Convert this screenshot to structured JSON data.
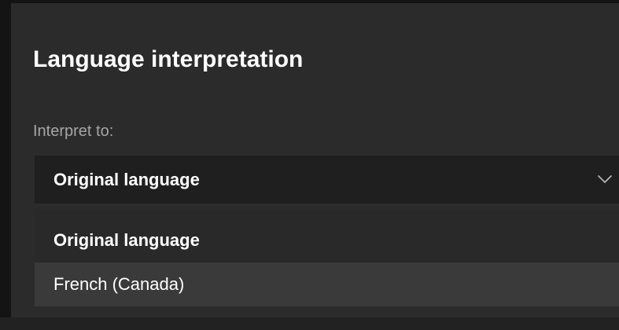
{
  "dialog": {
    "title": "Language interpretation",
    "field_label": "Interpret to:",
    "select": {
      "selected_value": "Original language",
      "icon": "chevron-down-icon"
    },
    "options": [
      {
        "label": "Original language",
        "selected": true
      },
      {
        "label": "French (Canada)",
        "hovered": true
      }
    ]
  },
  "colors": {
    "panel_background": "#2b2b2b",
    "select_background": "#1f1f1f",
    "hover_background": "#3a3a3a",
    "text_primary": "#ffffff",
    "text_secondary": "#a6a6a6"
  }
}
